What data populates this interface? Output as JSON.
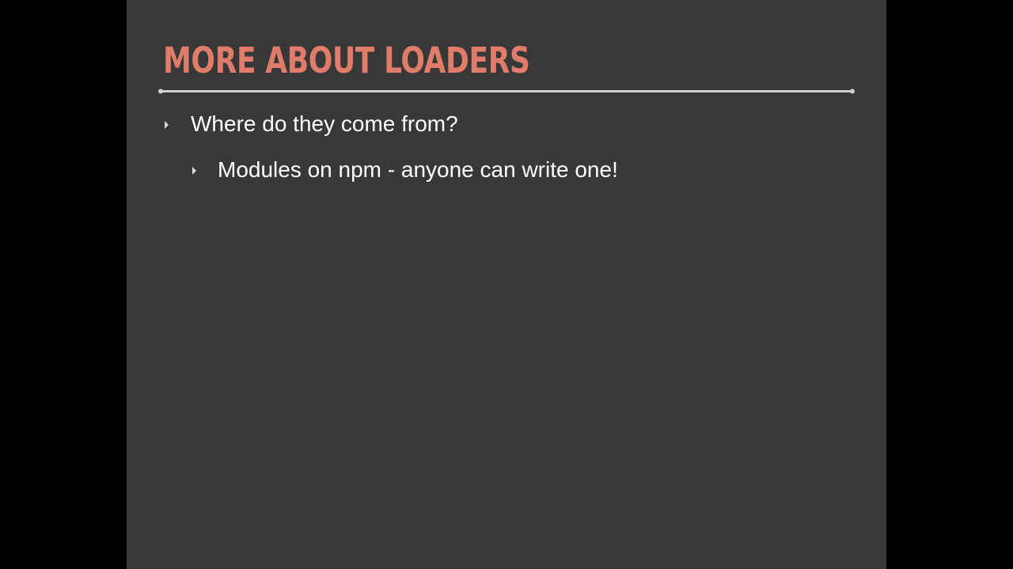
{
  "slide": {
    "title": "MORE ABOUT LOADERS",
    "bullets": [
      {
        "text": "Where do they come from?",
        "level": 1
      },
      {
        "text": "Modules on npm - anyone can write one!",
        "level": 2
      }
    ]
  },
  "colors": {
    "background_outer": "#000000",
    "slide_background": "#383838",
    "title_color": "#df7d6a",
    "text_color": "#ffffff",
    "bullet_color": "#d8d8d8",
    "rule_color": "#d0d0d0"
  },
  "icons": {
    "bullet_marker": "triangle-right-icon"
  }
}
